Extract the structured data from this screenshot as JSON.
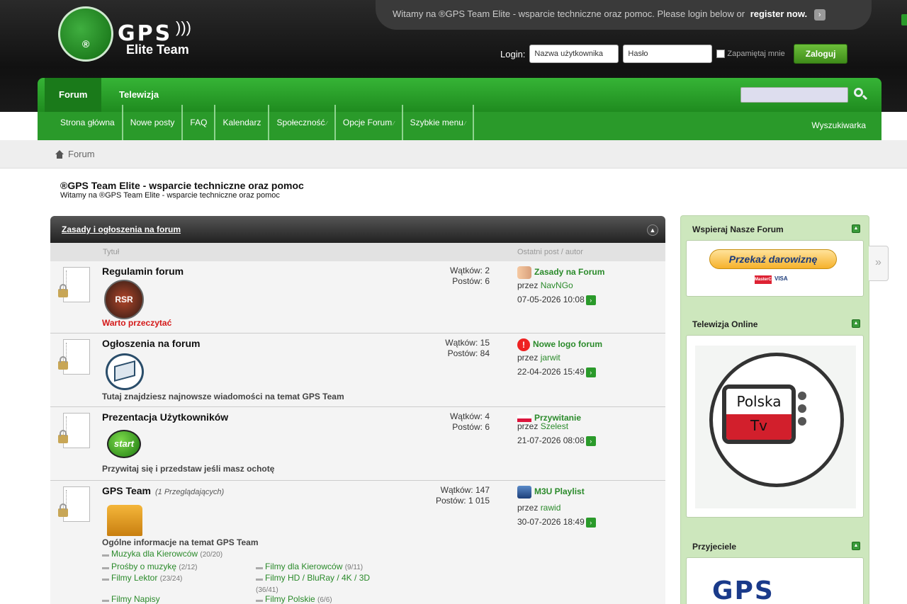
{
  "header": {
    "welcome": "Witamy na ®GPS Team Elite - wsparcie techniczne oraz pomoc. Please login below or",
    "register": "register now.",
    "logo_gps": "GPS",
    "logo_elite": "Elite Team",
    "logo_reg": "®",
    "login_label": "Login:",
    "username_value": "Nazwa użytkownika",
    "password_value": "Hasło",
    "remember_label": "Zapamiętaj mnie",
    "login_button": "Zaloguj"
  },
  "nav": {
    "tabs": [
      {
        "label": "Forum"
      },
      {
        "label": "Telewizja"
      }
    ],
    "search_value": "",
    "sub": [
      {
        "label": "Strona główna"
      },
      {
        "label": "Nowe posty"
      },
      {
        "label": "FAQ"
      },
      {
        "label": "Kalendarz"
      },
      {
        "label": "Społeczność"
      },
      {
        "label": "Opcje Forum"
      },
      {
        "label": "Szybkie menu"
      }
    ],
    "search_link": "Wyszukiwarka"
  },
  "breadcrumb": {
    "current": "Forum"
  },
  "page": {
    "title": "®GPS Team Elite - wsparcie techniczne oraz pomoc",
    "subtitle": "Witamy na ®GPS Team Elite - wsparcie techniczne oraz pomoc"
  },
  "forum": {
    "category": "Zasady i ogłoszenia na forum",
    "col_title": "Tytuł",
    "col_last": "Ostatni post / autor",
    "rows": [
      {
        "title": "Regulamin forum",
        "img_text": "RSR",
        "desc": "Warto przeczytać",
        "threads": "Wątków: 2",
        "posts": "Postów: 6",
        "last_title": "Zasady na Forum",
        "last_by": "przez",
        "last_author": "NavNGo",
        "last_date": "07-05-2026 10:08"
      },
      {
        "title": "Ogłoszenia na forum",
        "desc": "Tutaj znajdziesz najnowsze wiadomości na temat GPS Team",
        "threads": "Wątków: 15",
        "posts": "Postów: 84",
        "last_title": "Nowe logo forum",
        "last_by": "przez",
        "last_author": "jarwit",
        "last_date": "22-04-2026 15:49"
      },
      {
        "title": "Prezentacja Użytkowników",
        "img_text": "start",
        "desc": "Przywitaj się i przedstaw jeśli masz ochotę",
        "threads": "Wątków: 4",
        "posts": "Postów: 6",
        "last_title": "Przywitanie",
        "last_by": "przez",
        "last_author": "Szelest",
        "last_date": "21-07-2026 08:08"
      },
      {
        "title": "GPS Team",
        "viewing": "(1 Przeglądających)",
        "desc": "Ogólne informacje na temat GPS Team",
        "threads": "Wątków: 147",
        "posts": "Postów: 1 015",
        "last_title": "M3U Playlist",
        "last_by": "przez",
        "last_author": "rawid",
        "last_date": "30-07-2026 18:49",
        "subforums": [
          {
            "name": "Muzyka dla Kierowców",
            "count": "(20/20)"
          },
          {
            "name": "Prośby o muzykę",
            "count": "(2/12)"
          },
          {
            "name": "Filmy dla Kierowców",
            "count": "(9/11)"
          },
          {
            "name": "Filmy Lektor",
            "count": "(23/24)"
          },
          {
            "name": "Filmy HD / BluRay / 4K / 3D",
            "count": "(36/41)"
          },
          {
            "name": "Filmy Napisy",
            "count": ""
          },
          {
            "name": "Filmy Polskie",
            "count": "(6/6)"
          }
        ]
      }
    ]
  },
  "sidebar": {
    "boxes": [
      {
        "title": "Wspieraj Nasze Forum",
        "button": "Przekaż darowiznę",
        "cards": [
          "MasterCard",
          "VISA"
        ]
      },
      {
        "title": "Telewizja Online",
        "tv_top": "Polska",
        "tv_bottom": "Tv"
      },
      {
        "title": "Przyjeciele",
        "logo": "GPS"
      }
    ]
  }
}
